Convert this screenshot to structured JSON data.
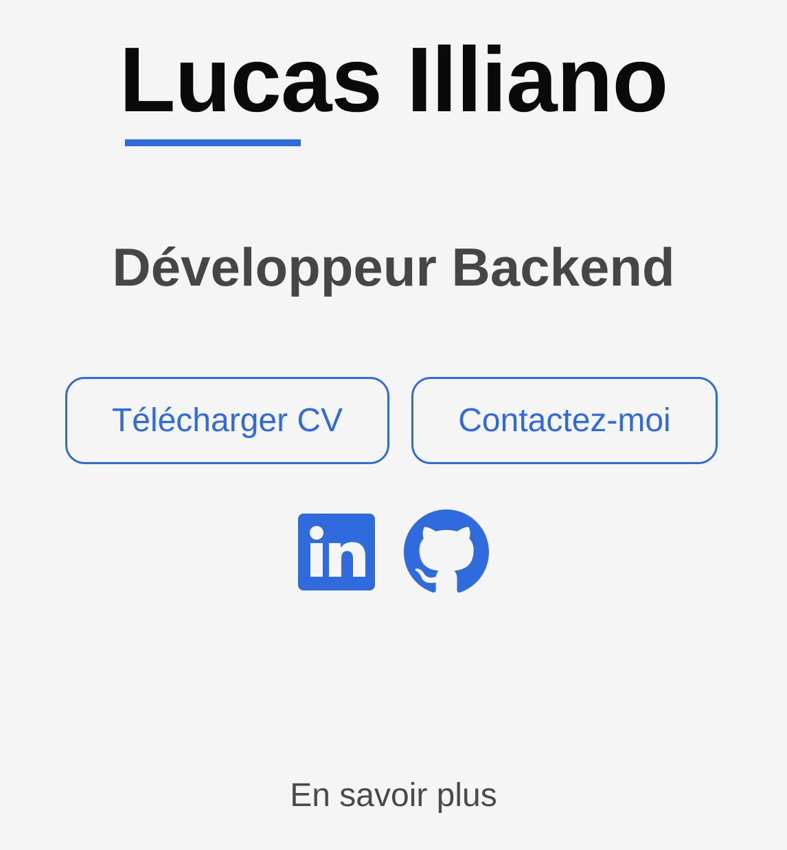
{
  "header": {
    "name": "Lucas Illiano",
    "role": "Développeur Backend"
  },
  "actions": {
    "download_cv_label": "Télécharger CV",
    "contact_label": "Contactez-moi"
  },
  "social": [
    {
      "icon": "linkedin-icon",
      "label": "in"
    },
    {
      "icon": "github-icon"
    }
  ],
  "footer": {
    "more_label": "En savoir plus"
  },
  "colors": {
    "accent": "#2f6bdc",
    "background": "#f5f5f5",
    "title": "#0a0a0a",
    "subtitle": "#464646",
    "muted_text": "#4a4a4a"
  }
}
